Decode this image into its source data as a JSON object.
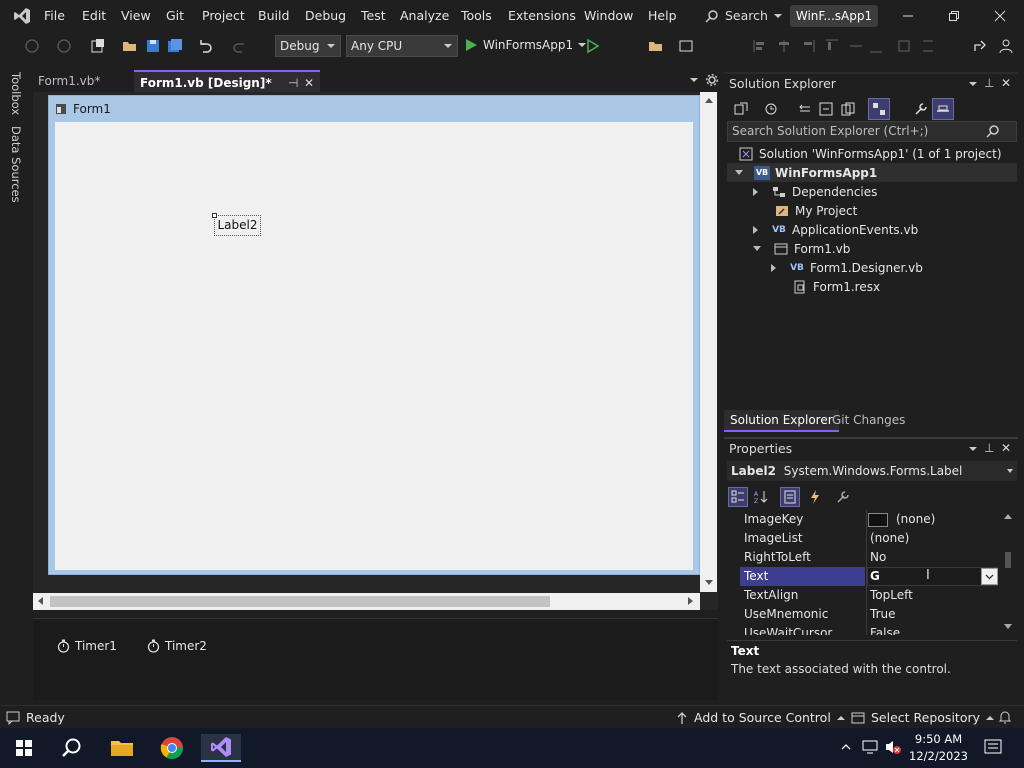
{
  "menu": {
    "items": [
      "File",
      "Edit",
      "View",
      "Git",
      "Project",
      "Build",
      "Debug",
      "Test",
      "Analyze",
      "Tools",
      "Extensions",
      "Window",
      "Help"
    ],
    "search_label": "Search",
    "window_title": "WinF...sApp1"
  },
  "toolbar": {
    "config": "Debug",
    "platform": "Any CPU",
    "run_label": "WinFormsApp1"
  },
  "side_tabs": [
    "Toolbox",
    "Data Sources"
  ],
  "doc_tabs": [
    {
      "label": "Form1.vb*",
      "active": false
    },
    {
      "label": "Form1.vb [Design]*",
      "active": true
    }
  ],
  "designer": {
    "form_title": "Form1",
    "label_text": "Label2",
    "tray": [
      "Timer1",
      "Timer2"
    ]
  },
  "solution_explorer": {
    "title": "Solution Explorer",
    "search_placeholder": "Search Solution Explorer (Ctrl+;)",
    "tree": [
      {
        "label": "Solution 'WinFormsApp1' (1 of 1 project)",
        "icon": "solution-icon"
      },
      {
        "label": "WinFormsApp1",
        "icon": "vb-project-icon"
      },
      {
        "label": "Dependencies",
        "icon": "dependencies-icon"
      },
      {
        "label": "My Project",
        "icon": "wrench-icon"
      },
      {
        "label": "ApplicationEvents.vb",
        "icon": "vb-file-icon"
      },
      {
        "label": "Form1.vb",
        "icon": "form-icon"
      },
      {
        "label": "Form1.Designer.vb",
        "icon": "vb-file-icon"
      },
      {
        "label": "Form1.resx",
        "icon": "resx-icon"
      }
    ],
    "tabs": [
      "Solution Explorer",
      "Git Changes"
    ],
    "vb_badge": "VB"
  },
  "properties": {
    "title": "Properties",
    "object_name": "Label2",
    "object_type": "System.Windows.Forms.Label",
    "rows": [
      {
        "name": "ImageKey",
        "value": "(none)"
      },
      {
        "name": "ImageList",
        "value": "(none)"
      },
      {
        "name": "RightToLeft",
        "value": "No"
      },
      {
        "name": "Text",
        "value": "G"
      },
      {
        "name": "TextAlign",
        "value": "TopLeft"
      },
      {
        "name": "UseMnemonic",
        "value": "True"
      },
      {
        "name": "UseWaitCursor",
        "value": "False"
      }
    ],
    "desc_title": "Text",
    "desc_text": "The text associated with the control."
  },
  "status": {
    "ready": "Ready",
    "source_control": "Add to Source Control",
    "repository": "Select Repository"
  },
  "taskbar": {
    "time": "9:50 AM",
    "date": "12/2/2023"
  },
  "colors": {
    "accent": "#8b5cf6",
    "selection": "#3e3e8f",
    "form_client": "#f0f0f0"
  }
}
